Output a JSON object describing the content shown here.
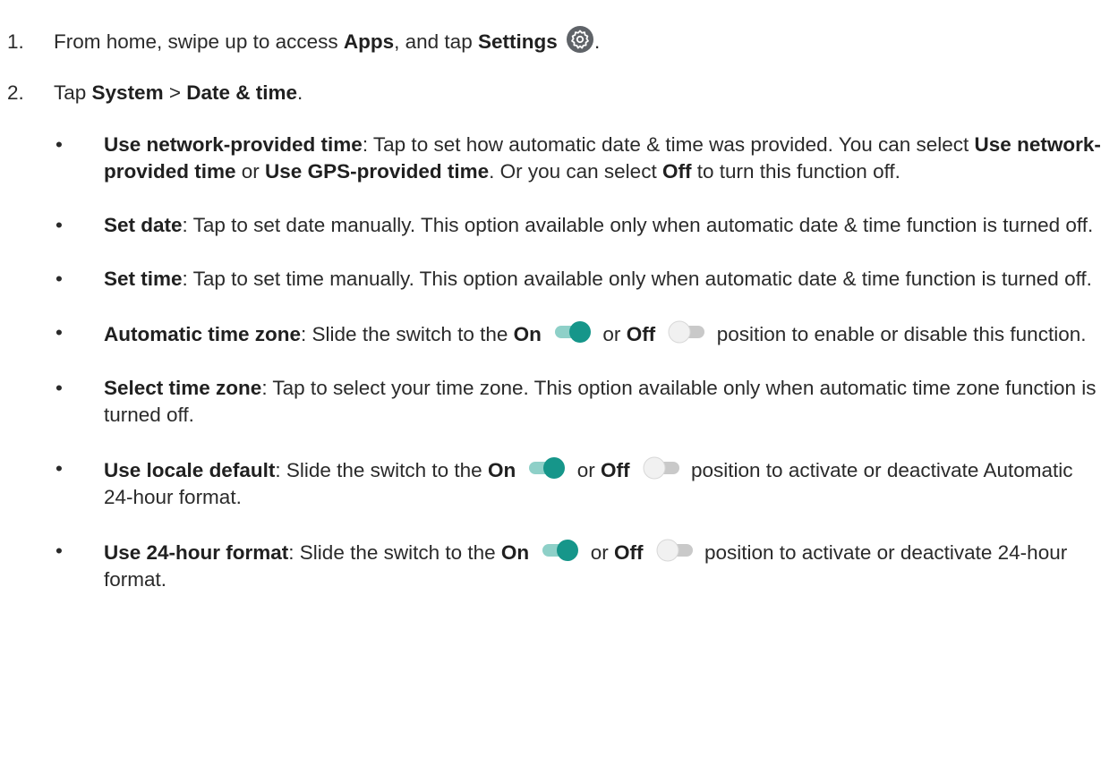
{
  "steps": [
    {
      "num": "1.",
      "t1": "From home, swipe up to access ",
      "b1": "Apps",
      "t2": ", and tap ",
      "b2": "Settings",
      "t3": ".",
      "icon": "settings-gear-icon"
    },
    {
      "num": "2.",
      "t1": "Tap ",
      "b1": "System",
      "t2": " > ",
      "b2": "Date & time",
      "t3": "."
    }
  ],
  "bullet_glyph": "•",
  "bullets": [
    {
      "b1": "Use network-provided time",
      "t1": ": Tap to set how automatic date & time was provided. You can select ",
      "b2": "Use network-provided time",
      "t2": " or ",
      "b3": "Use GPS-provided time",
      "t3": ". Or you can select ",
      "b4": "Off",
      "t4": " to turn this function off."
    },
    {
      "b1": "Set date",
      "t1": ": Tap to set date manually. This option available only when automatic date & time function is turned off."
    },
    {
      "b1": "Set time",
      "t1": ": Tap to set time manually. This option available only when automatic date & time function is turned off."
    },
    {
      "b1": "Automatic time zone",
      "t1": ": Slide the switch to the ",
      "on": "On",
      "or": " or ",
      "off": "Off",
      "t2": " position to enable or disable this function."
    },
    {
      "b1": "Select time zone",
      "t1": ": Tap to select your time zone. This option available only when automatic time zone function is turned off."
    },
    {
      "b1": "Use locale default",
      "t1": ": Slide the switch to the ",
      "on": "On",
      "or": " or ",
      "off": "Off",
      "t2": " position to activate or deactivate Automatic 24-hour format."
    },
    {
      "b1": "Use 24-hour format",
      "t1": ": Slide the switch to the ",
      "on": "On",
      "or": " or ",
      "off": "Off",
      "t2": " position to activate or deactivate 24-hour format."
    }
  ],
  "colors": {
    "switch_on_thumb": "#16968a",
    "switch_on_track": "#8ed0c8",
    "switch_off_thumb": "#e6e6e6",
    "switch_off_track": "#c9c9c9",
    "gear_icon_bg": "#5f6368"
  }
}
